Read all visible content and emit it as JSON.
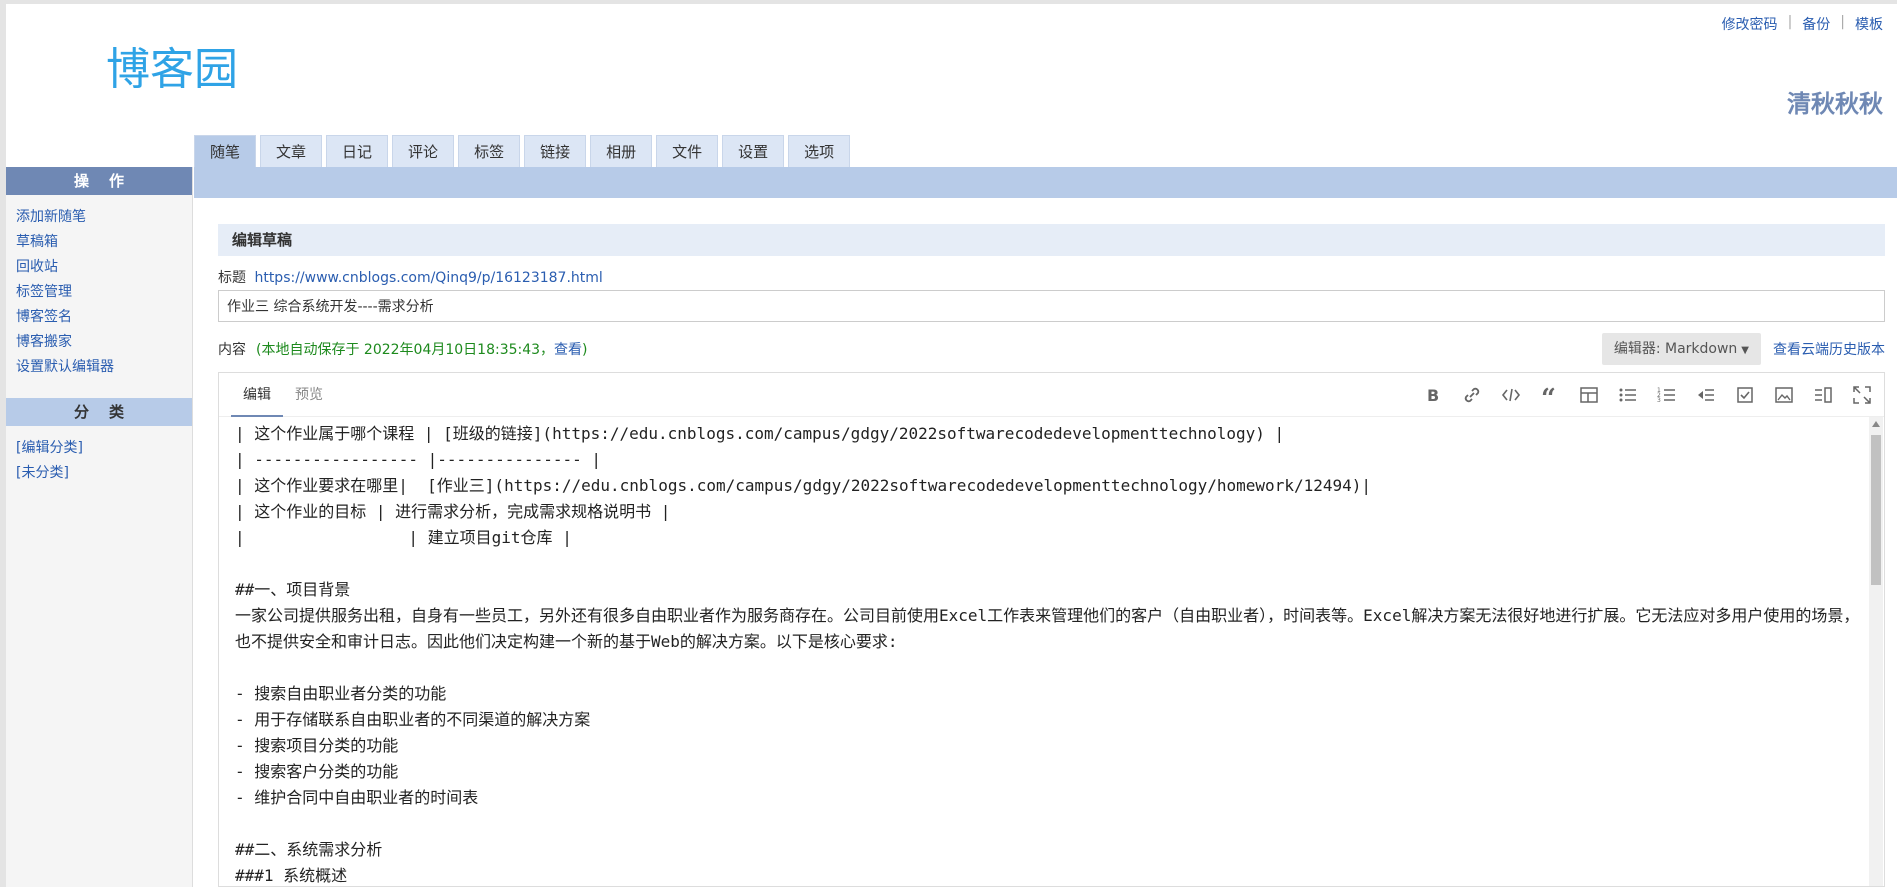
{
  "header": {
    "logo_text": "博客园",
    "top_links": [
      "修改密码",
      "备份",
      "模板"
    ],
    "blog_name": "清秋秋秋"
  },
  "tabs": [
    {
      "label": "随笔",
      "active": true
    },
    {
      "label": "文章"
    },
    {
      "label": "日记"
    },
    {
      "label": "评论"
    },
    {
      "label": "标签"
    },
    {
      "label": "链接"
    },
    {
      "label": "相册"
    },
    {
      "label": "文件"
    },
    {
      "label": "设置"
    },
    {
      "label": "选项"
    }
  ],
  "sidebar": {
    "ops_title": "操作",
    "ops_items": [
      "添加新随笔",
      "草稿箱",
      "回收站",
      "标签管理",
      "博客签名",
      "博客搬家",
      "设置默认编辑器"
    ],
    "cat_title": "分类",
    "cat_items": [
      "[编辑分类]",
      "[未分类]"
    ]
  },
  "main": {
    "section_title": "编辑草稿",
    "title_label": "标题",
    "title_url": "https://www.cnblogs.com/Qinq9/p/16123187.html",
    "title_value": "作业三 综合系统开发----需求分析",
    "content_label": "内容",
    "autosave_prefix": "(本地自动保存于 2022年04月10日18:35:43，",
    "autosave_link": "查看",
    "autosave_suffix": ")",
    "editor_select": "编辑器: Markdown",
    "history_link": "查看云端历史版本"
  },
  "editor": {
    "tabs": [
      {
        "label": "编辑",
        "active": true
      },
      {
        "label": "预览"
      }
    ],
    "tools": [
      "bold-icon",
      "link-icon",
      "code-icon",
      "quote-icon",
      "table-icon",
      "bullet-list-icon",
      "ordered-list-icon",
      "indent-icon",
      "checkbox-icon",
      "image-icon",
      "split-view-icon",
      "fullscreen-icon"
    ],
    "lines": [
      "| 这个作业属于哪个课程 | [班级的链接](https://edu.cnblogs.com/campus/gdgy/2022softwarecodedevelopmenttechnology) |",
      "| ----------------- |--------------- |",
      "| 这个作业要求在哪里|  [作业三](https://edu.cnblogs.com/campus/gdgy/2022softwarecodedevelopmenttechnology/homework/12494)|",
      "| 这个作业的目标 | 进行需求分析，完成需求规格说明书 |",
      "|                 | 建立项目git仓库 |",
      "",
      "##一、项目背景",
      "一家公司提供服务出租，自身有一些员工，另外还有很多自由职业者作为服务商存在。公司目前使用Excel工作表来管理他们的客户（自由职业者），时间表等。Excel解决方案无法很好地进行扩展。它无法应对多用户使用的场景，也不提供安全和审计日志。因此他们决定构建一个新的基于Web的解决方案。以下是核心要求:",
      "",
      "- 搜索自由职业者分类的功能",
      "- 用于存储联系自由职业者的不同渠道的解决方案",
      "- 搜索项目分类的功能",
      "- 搜索客户分类的功能",
      "- 维护合同中自由职业者的时间表",
      "",
      "##二、系统需求分析",
      "###1 系统概述"
    ]
  }
}
